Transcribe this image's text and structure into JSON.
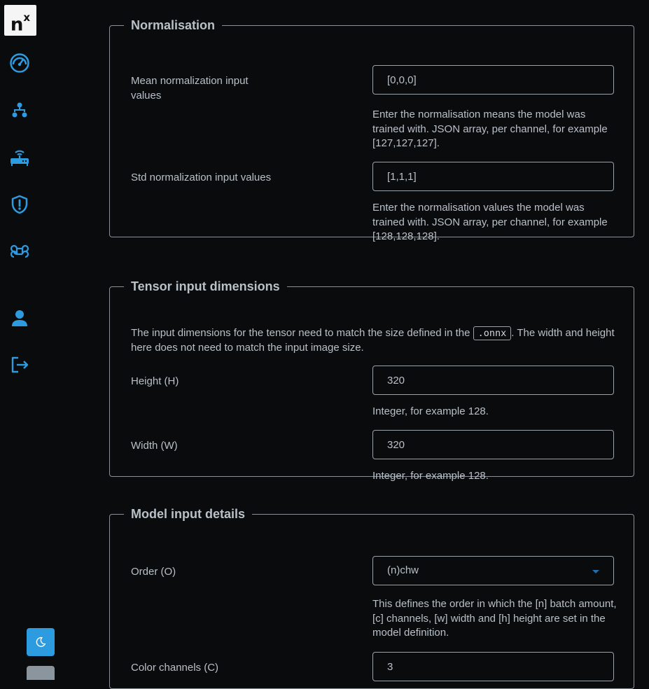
{
  "sidebar": {
    "logo_text": "n",
    "logo_sup": "x",
    "items": [
      {
        "icon": "dashboard-gauge-icon"
      },
      {
        "icon": "network-tree-icon"
      },
      {
        "icon": "router-wifi-icon"
      },
      {
        "icon": "shield-alert-icon"
      },
      {
        "icon": "command-key-icon"
      },
      {
        "icon": "user-icon"
      },
      {
        "icon": "logout-icon"
      }
    ],
    "theme_icon": "moon-icon",
    "accent_color": "#2d9be0"
  },
  "normalisation": {
    "title": "Normalisation",
    "mean_label": "Mean normalization input values",
    "mean_value": "[0,0,0]",
    "mean_help": "Enter the normalisation means the model was trained with. JSON array, per channel, for example [127,127,127].",
    "std_label": "Std normalization input values",
    "std_value": "[1,1,1]",
    "std_help": "Enter the normalisation values the model was trained with. JSON array, per channel, for example [128,128,128]."
  },
  "tensor": {
    "title": "Tensor input dimensions",
    "desc_before": "The input dimensions for the tensor need to match the size defined in the ",
    "desc_code": ".onnx",
    "desc_after": ". The width and height here does not need to match the input image size.",
    "height_label": "Height (H)",
    "height_value": "320",
    "height_help": "Integer, for example 128.",
    "width_label": "Width (W)",
    "width_value": "320",
    "width_help": "Integer, for example 128."
  },
  "model": {
    "title": "Model input details",
    "order_label": "Order (O)",
    "order_value": "(n)chw",
    "order_help": "This defines the order in which the [n] batch amount, [c] channels, [w] width and [h] height are set in the model definition.",
    "channels_label": "Color channels (C)",
    "channels_value": "3"
  }
}
